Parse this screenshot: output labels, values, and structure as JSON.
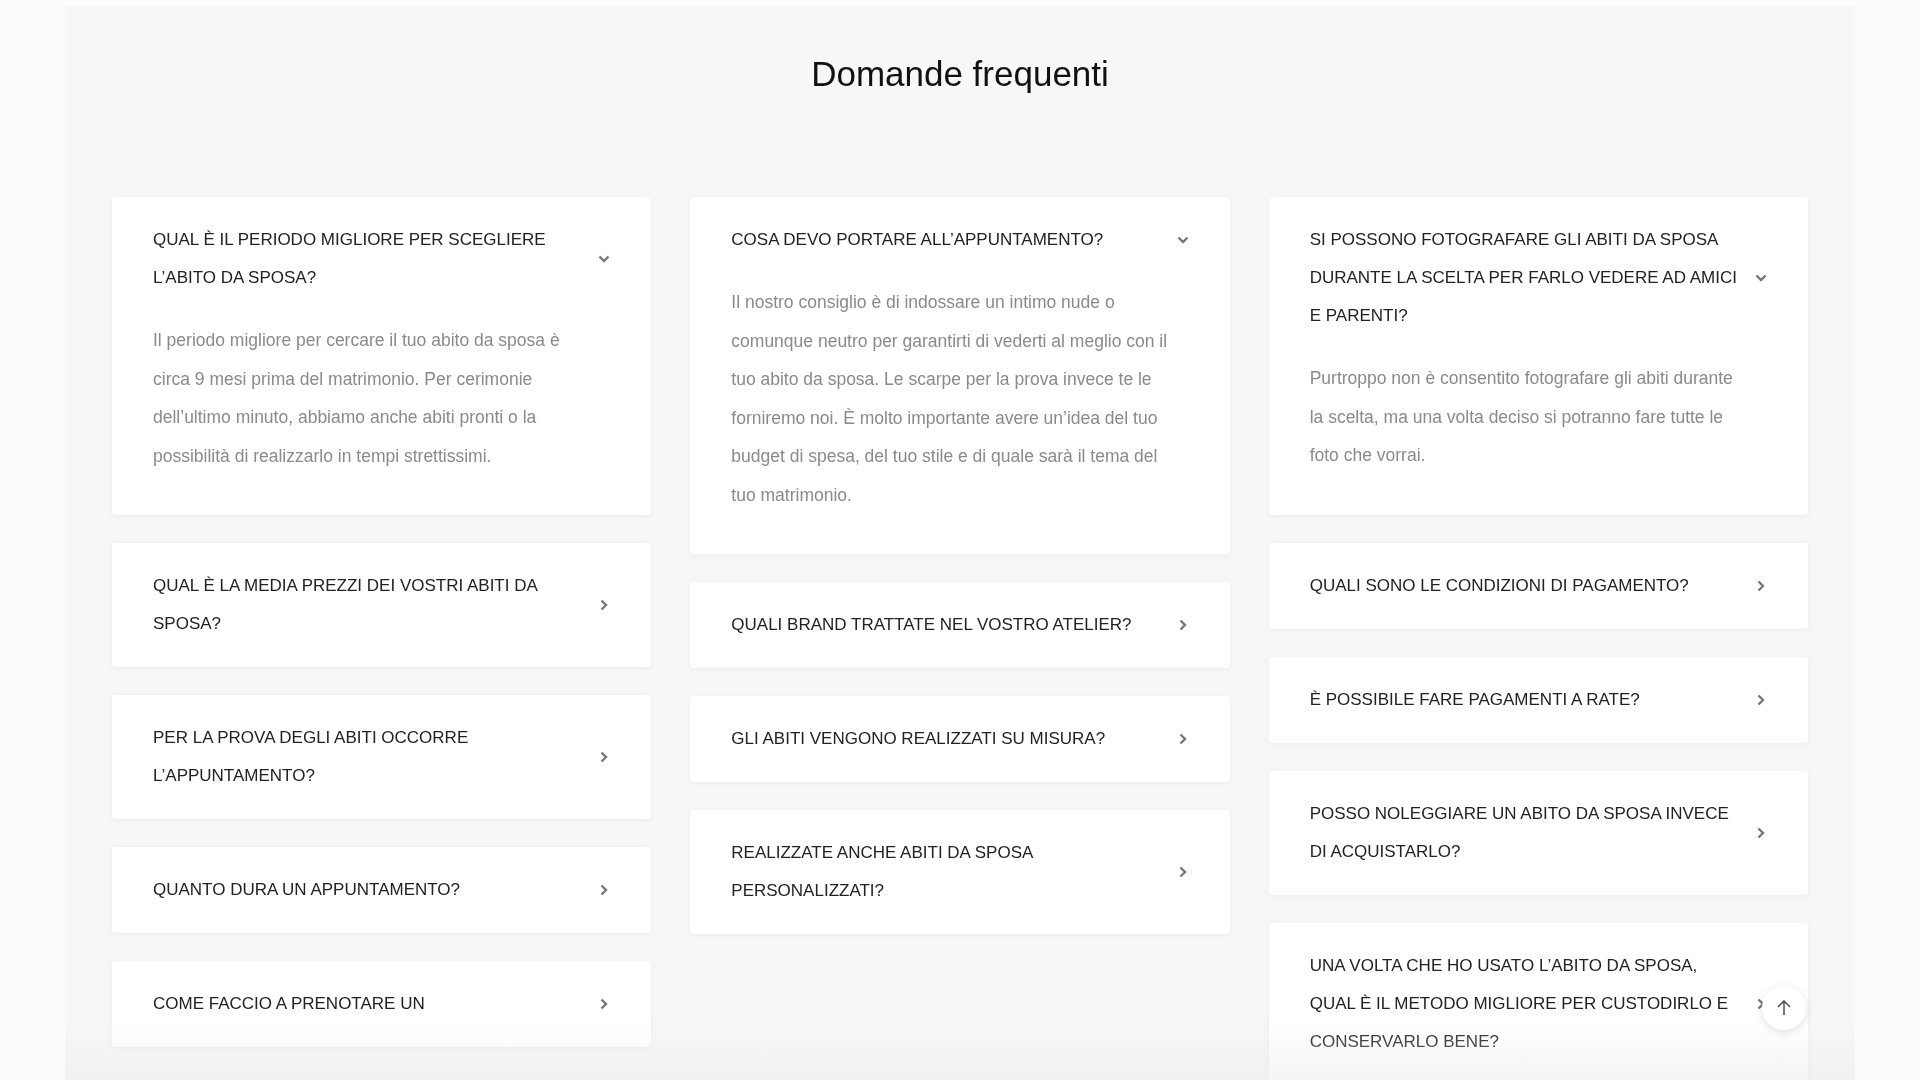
{
  "page": {
    "title": "Domande frequenti"
  },
  "faq": {
    "columns": [
      {
        "items": [
          {
            "question": "QUAL È IL PERIODO MIGLIORE PER SCEGLIERE L’ABITO DA SPOSA?",
            "expanded": true,
            "answer": "Il periodo migliore per cercare il tuo abito da sposa è circa 9 mesi prima del matrimonio. Per cerimonie dell’ultimo minuto, abbiamo anche abiti pronti o la possibilità di realizzarlo in tempi strettissimi."
          },
          {
            "question": "QUAL È LA MEDIA PREZZI DEI VOSTRI ABITI DA SPOSA?",
            "expanded": false
          },
          {
            "question": "PER LA PROVA DEGLI ABITI OCCORRE L’APPUNTAMENTO?",
            "expanded": false
          },
          {
            "question": "QUANTO DURA UN APPUNTAMENTO?",
            "expanded": false
          },
          {
            "question": "COME FACCIO A PRENOTARE UN",
            "expanded": false
          }
        ]
      },
      {
        "items": [
          {
            "question": "COSA DEVO PORTARE ALL’APPUNTAMENTO?",
            "expanded": true,
            "answer": "Il nostro consiglio è di indossare un intimo nude o comunque neutro per garantirti di vederti al meglio con il tuo abito da sposa. Le scarpe per la prova invece te le forniremo noi. È molto importante avere un’idea del tuo budget di spesa, del tuo stile e di quale sarà il tema del tuo matrimonio."
          },
          {
            "question": "QUALI BRAND TRATTATE NEL VOSTRO ATELIER?",
            "expanded": false
          },
          {
            "question": "GLI ABITI VENGONO REALIZZATI SU MISURA?",
            "expanded": false
          },
          {
            "question": "REALIZZATE ANCHE ABITI DA SPOSA PERSONALIZZATI?",
            "expanded": false
          }
        ]
      },
      {
        "items": [
          {
            "question": "SI POSSONO FOTOGRAFARE GLI ABITI DA SPOSA DURANTE LA SCELTA PER FARLO VEDERE AD AMICI E PARENTI?",
            "expanded": true,
            "answer": "Purtroppo non è consentito fotografare gli abiti durante la scelta, ma una volta deciso si potranno fare tutte le foto che vorrai."
          },
          {
            "question": "QUALI SONO LE CONDIZIONI DI PAGAMENTO?",
            "expanded": false
          },
          {
            "question": "È POSSIBILE FARE PAGAMENTI A RATE?",
            "expanded": false
          },
          {
            "question": "POSSO NOLEGGIARE UN ABITO DA SPOSA INVECE DI ACQUISTARLO?",
            "expanded": false
          },
          {
            "question": "UNA VOLTA CHE HO USATO L’ABITO DA SPOSA, QUAL È IL METODO MIGLIORE PER CUSTODIRLO E CONSERVARLO BENE?",
            "expanded": false
          }
        ]
      }
    ]
  }
}
